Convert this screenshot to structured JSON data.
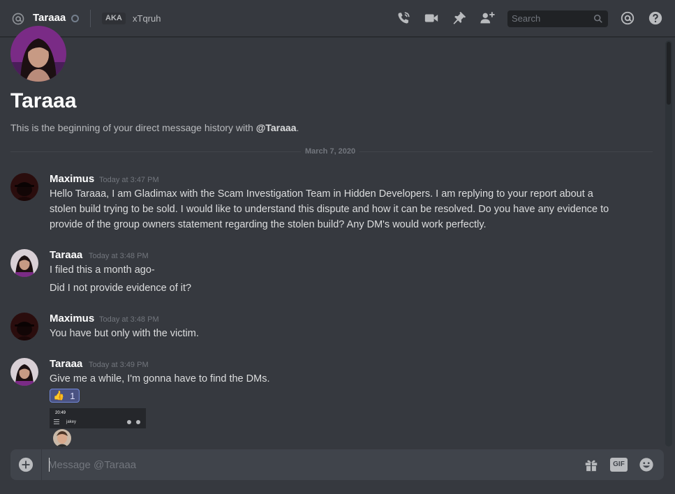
{
  "header": {
    "name": "Taraaa",
    "aka_label": "AKA",
    "alias": "xTqruh",
    "search_placeholder": "Search"
  },
  "welcome": {
    "name": "Taraaa",
    "subtitle_prefix": "This is the beginning of your direct message history with ",
    "subtitle_mention": "@Taraaa",
    "subtitle_suffix": "."
  },
  "date_divider": "March 7, 2020",
  "messages": [
    {
      "author": "Maximus",
      "timestamp": "Today at 3:47 PM",
      "lines": [
        "Hello Taraaa, I am Gladimax with the Scam Investigation Team in Hidden Developers. I am replying to your report about a",
        "stolen build trying to be sold. I would like to understand this dispute and how it can be resolved. Do you have any evidence to",
        "provide of the group owners statement regarding the stolen build? Any DM's would work perfectly."
      ]
    },
    {
      "author": "Taraaa",
      "timestamp": "Today at 3:48 PM",
      "lines": [
        "I filed this a month ago-",
        "Did I not provide evidence of it?"
      ]
    },
    {
      "author": "Maximus",
      "timestamp": "Today at 3:48 PM",
      "lines": [
        "You have but only with the victim."
      ]
    },
    {
      "author": "Taraaa",
      "timestamp": "Today at 3:49 PM",
      "lines": [
        "Give me a while, I'm gonna have to find the DMs."
      ]
    }
  ],
  "reaction": {
    "icon": "thumbs-up-icon",
    "emoji": "👍",
    "count": "1"
  },
  "attachment": {
    "time": "20:49",
    "user": "jakey"
  },
  "composer": {
    "placeholder": "Message @Taraaa",
    "gif_label": "GIF"
  },
  "colors": {
    "background": "#36393f",
    "accent": "#7289da",
    "text": "#dcddde",
    "muted": "#72767d"
  }
}
